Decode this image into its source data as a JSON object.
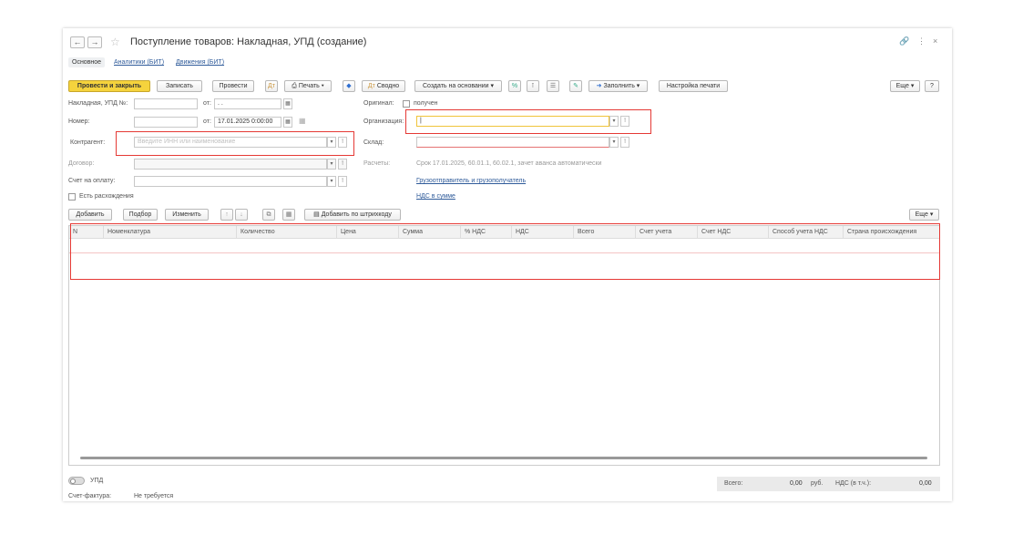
{
  "window": {
    "title": "Поступление товаров: Накладная, УПД (создание)",
    "title_icons": {
      "link": "link-icon",
      "menu": "more-icon",
      "close": "close-icon"
    }
  },
  "tabs": [
    {
      "label": "Основное"
    },
    {
      "label": "Аналитики (БИТ)"
    },
    {
      "label": "Движения (БИТ)"
    }
  ],
  "toolbar": {
    "post_close": "Провести и закрыть",
    "save": "Записать",
    "post": "Провести",
    "print": "Печать",
    "summary": "Сводно",
    "create_based": "Создать на основании",
    "fill": "Заполнить",
    "print_settings": "Настройка печати",
    "more": "Еще",
    "help": "?"
  },
  "form": {
    "invoice_label": "Накладная, УПД №:",
    "invoice_from": "от:",
    "invoice_date": ". .",
    "number_label": "Номер:",
    "number_from": "от:",
    "number_date": "17.01.2025  0:00:00",
    "original_label": "Оригинал:",
    "original_value": "получен",
    "org_label": "Организация:",
    "org_value": "|",
    "counterparty_label": "Контрагент:",
    "counterparty_placeholder": "Введите ИНН или наименование",
    "warehouse_label": "Склад:",
    "contract_label": "Договор:",
    "calc_label": "Расчеты:",
    "calc_value": "Срок 17.01.2025, 60.01.1, 60.02.1, зачет аванса автоматически",
    "invoice_pay_label": "Счет на оплату:",
    "shipper_link": "Грузоотправитель и грузополучатель",
    "vat_link": "НДС в сумме",
    "discrepancy_label": "Есть расхождения"
  },
  "table_toolbar": {
    "add": "Добавить",
    "pick": "Подбор",
    "change": "Изменить",
    "add_barcode": "Добавить по штрихкоду",
    "more": "Еще"
  },
  "table": {
    "columns": [
      "N",
      "Номенклатура",
      "Количество",
      "Цена",
      "Сумма",
      "% НДС",
      "НДС",
      "Всего",
      "Счет учета",
      "Счет НДС",
      "Способ учета НДС",
      "Страна происхождения"
    ],
    "rows": []
  },
  "footer": {
    "upd_label": "УПД",
    "invoice_label": "Счет-фактура:",
    "invoice_value": "Не требуется",
    "total_label": "Всего:",
    "total_value": "0,00",
    "currency": "руб.",
    "vat_label": "НДС (в т.ч.):",
    "vat_value": "0,00"
  }
}
